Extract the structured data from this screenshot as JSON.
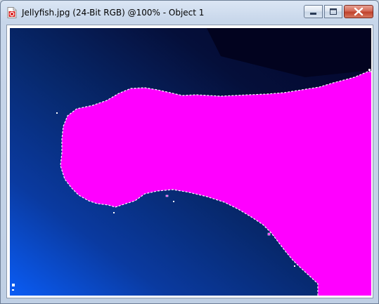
{
  "window": {
    "title": "Jellyfish.jpg (24-Bit RGB) @100% - Object 1"
  },
  "icons": {
    "app": "psp-document-icon",
    "minimize": "minimize-icon",
    "maximize": "maximize-icon",
    "close": "close-icon"
  },
  "colors": {
    "selection_fill": "#ff00ff",
    "background_dark": "#03052a",
    "background_light": "#0a5cf5"
  }
}
